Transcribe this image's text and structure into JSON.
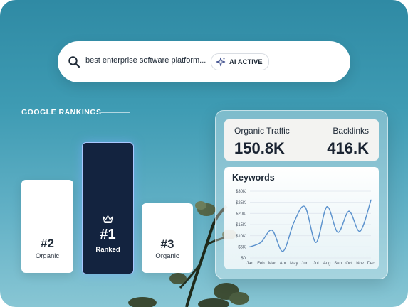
{
  "search": {
    "query": "best enterprise software platform...",
    "badge_label": "AI ACTIVE"
  },
  "rankings": {
    "heading": "GOOGLE RANKINGS",
    "cards": [
      {
        "rank": "#2",
        "label": "Organic"
      },
      {
        "rank": "#1",
        "label": "Ranked"
      },
      {
        "rank": "#3",
        "label": "Organic"
      }
    ]
  },
  "stats": {
    "traffic_label": "Organic Traffic",
    "traffic_value": "150.8K",
    "backlinks_label": "Backlinks",
    "backlinks_value": "416.K"
  },
  "keywords": {
    "title": "Keywords"
  },
  "chart_data": {
    "type": "line",
    "title": "Keywords",
    "categories": [
      "Jan",
      "Feb",
      "Mar",
      "Apr",
      "May",
      "Jun",
      "Jul",
      "Aug",
      "Sep",
      "Oct",
      "Nov",
      "Dec"
    ],
    "y_ticks": [
      "$0",
      "$5K",
      "$10K",
      "$15K",
      "$20K",
      "$25K",
      "$30K"
    ],
    "ylim": [
      0,
      30000
    ],
    "values": [
      5000,
      7000,
      12500,
      3000,
      16000,
      23000,
      7000,
      23000,
      11500,
      21000,
      12000,
      26000
    ],
    "line_color": "#4a86c8",
    "grid": true
  },
  "colors": {
    "background": "#3e9bb3",
    "rank1_card": "#13233f",
    "accent": "#4a86c8"
  }
}
